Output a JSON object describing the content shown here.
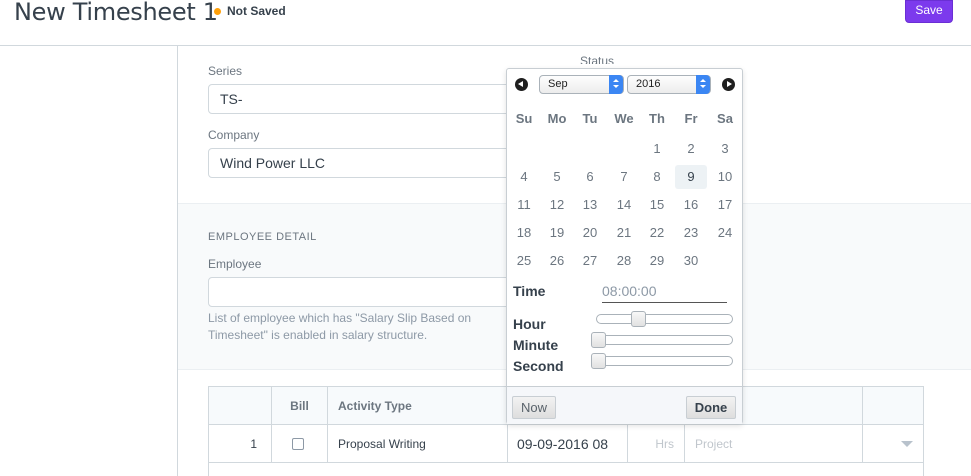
{
  "header": {
    "title": "New Timesheet 1",
    "status": "Not Saved",
    "save_label": "Save"
  },
  "form": {
    "series_label": "Series",
    "series_value": "TS-",
    "status_label": "Status",
    "company_label": "Company",
    "company_value": "Wind Power LLC",
    "employee_section": "EMPLOYEE DETAIL",
    "employee_label": "Employee",
    "employee_value": "",
    "employee_help": "List of employee which has \"Salary Slip Based on Timesheet\" is enabled in salary structure."
  },
  "table": {
    "headers": {
      "bill": "Bill",
      "activity_type": "Activity Type"
    },
    "rows": [
      {
        "idx": "1",
        "activity_type": "Proposal Writing",
        "from_time": "09-09-2016 08",
        "hours_placeholder": "Hrs",
        "project_placeholder": "Project"
      }
    ]
  },
  "datepicker": {
    "month": "Sep",
    "year": "2016",
    "weekdays": [
      "Su",
      "Mo",
      "Tu",
      "We",
      "Th",
      "Fr",
      "Sa"
    ],
    "days": [
      [
        "",
        "",
        "",
        "",
        "1",
        "2",
        "3"
      ],
      [
        "4",
        "5",
        "6",
        "7",
        "8",
        "9",
        "10"
      ],
      [
        "11",
        "12",
        "13",
        "14",
        "15",
        "16",
        "17"
      ],
      [
        "18",
        "19",
        "20",
        "21",
        "22",
        "23",
        "24"
      ],
      [
        "25",
        "26",
        "27",
        "28",
        "29",
        "30",
        ""
      ]
    ],
    "selected_day": "9",
    "time_label": "Time",
    "time_value": "08:00:00",
    "hour_label": "Hour",
    "minute_label": "Minute",
    "second_label": "Second",
    "hour_level": 0.33,
    "minute_level": 0,
    "second_level": 0,
    "now_label": "Now",
    "done_label": "Done"
  },
  "colors": {
    "accent": "#7c3aed",
    "status_dot": "#ffa00a"
  }
}
